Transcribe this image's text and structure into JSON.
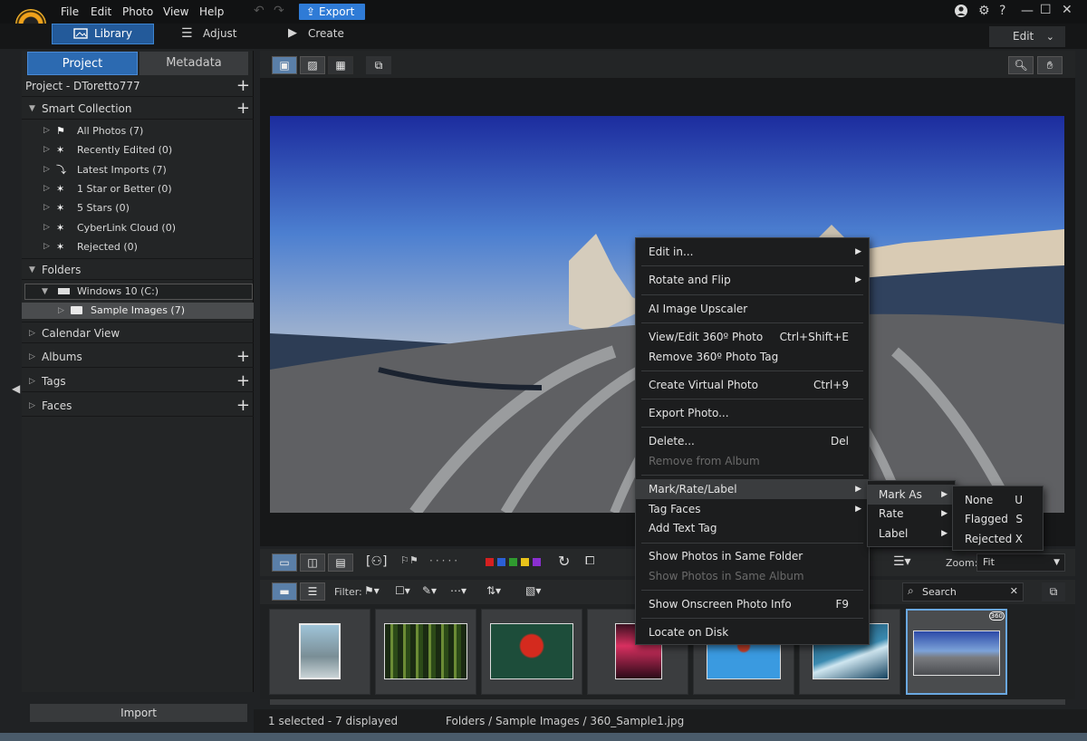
{
  "menu": {
    "file": "File",
    "edit": "Edit",
    "photo": "Photo",
    "view": "View",
    "help": "Help",
    "export": "Export"
  },
  "modes": {
    "library": "Library",
    "adjust": "Adjust",
    "create": "Create",
    "edit_dropdown": "Edit"
  },
  "panel_tabs": {
    "project": "Project",
    "metadata": "Metadata"
  },
  "project": {
    "title": "Project - DToretto777"
  },
  "smart_collection": {
    "title": "Smart Collection",
    "items": [
      {
        "label": "All Photos (7)",
        "icon": "photos-icon"
      },
      {
        "label": "Recently Edited (0)",
        "icon": "smart-icon"
      },
      {
        "label": "Latest Imports (7)",
        "icon": "import-icon"
      },
      {
        "label": "1 Star or Better (0)",
        "icon": "smart-icon"
      },
      {
        "label": "5 Stars (0)",
        "icon": "smart-icon"
      },
      {
        "label": "CyberLink Cloud (0)",
        "icon": "smart-icon"
      },
      {
        "label": "Rejected (0)",
        "icon": "smart-icon"
      }
    ]
  },
  "folders": {
    "title": "Folders",
    "drive": "Windows 10 (C:)",
    "sample": "Sample Images (7)"
  },
  "sections": {
    "calendar": "Calendar View",
    "albums": "Albums",
    "tags": "Tags",
    "faces": "Faces"
  },
  "import": "Import",
  "filter": {
    "label": "Filter:",
    "search_placeholder": "Search",
    "zoom_label": "Zoom:",
    "zoom_value": "Fit"
  },
  "color_labels": [
    "#d42020",
    "#2b5fd6",
    "#2f9a2f",
    "#e8c21a",
    "#8a2fd0"
  ],
  "thumb_badge": "360",
  "status": {
    "selection": "1 selected - 7 displayed",
    "path": "Folders / Sample Images / 360_Sample1.jpg"
  },
  "context_menu": {
    "items": [
      {
        "label": "Edit in...",
        "submenu": true
      },
      {
        "label": "Rotate and Flip",
        "submenu": true
      },
      {
        "label": "AI Image Upscaler"
      },
      {
        "label": "View/Edit 360º Photo",
        "shortcut": "Ctrl+Shift+E"
      },
      {
        "label": "Remove 360º Photo Tag"
      },
      {
        "label": "Create Virtual Photo",
        "shortcut": "Ctrl+9"
      },
      {
        "label": "Export Photo..."
      },
      {
        "label": "Delete...",
        "shortcut": "Del"
      },
      {
        "label": "Remove from Album",
        "disabled": true
      },
      {
        "label": "Mark/Rate/Label",
        "submenu": true,
        "highlighted": true
      },
      {
        "label": "Tag Faces",
        "submenu": true
      },
      {
        "label": "Add Text Tag"
      },
      {
        "label": "Show Photos in Same Folder"
      },
      {
        "label": "Show Photos in Same Album",
        "disabled": true
      },
      {
        "label": "Show Onscreen Photo Info",
        "shortcut": "F9"
      },
      {
        "label": "Locate on Disk"
      }
    ]
  },
  "submenu_mark": {
    "items": [
      {
        "label": "Mark As"
      },
      {
        "label": "Rate"
      },
      {
        "label": "Label"
      }
    ]
  },
  "submenu_markas": {
    "items": [
      {
        "label": "None",
        "shortcut": "U"
      },
      {
        "label": "Flagged",
        "shortcut": "S"
      },
      {
        "label": "Rejected",
        "shortcut": "X"
      }
    ]
  }
}
